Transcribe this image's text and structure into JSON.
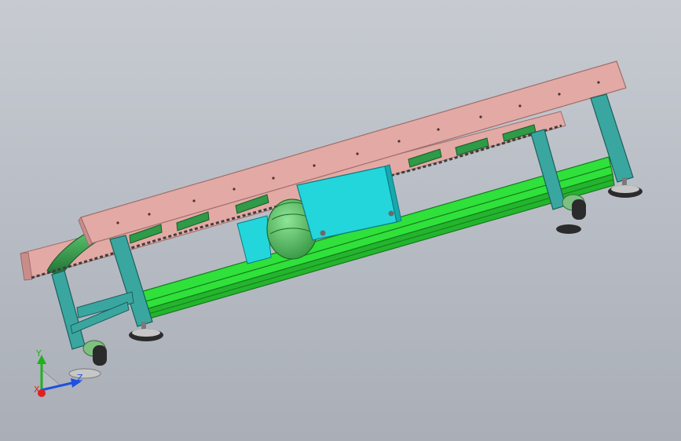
{
  "viewport": {
    "background_top": "#c7cbd1",
    "background_bottom": "#a9aeb7"
  },
  "model": {
    "colors": {
      "rail": "#e3a9a5",
      "rail_edge": "#9e6e6b",
      "leg": "#3aa6a0",
      "leg_edge": "#1c5f5b",
      "frame": "#2fe13a",
      "frame_edge": "#177a1d",
      "motor": "#5ed06a",
      "motor_cover": "#23d6dc",
      "roller": "#2f9a47",
      "chain": "#3d3d3d",
      "wheel": "#2b2b2b",
      "foot": "#c7c7c7"
    }
  },
  "triad": {
    "labels": {
      "x": "X",
      "y": "Y",
      "z": "Z"
    },
    "colors": {
      "x": "#e02020",
      "y": "#20b020",
      "z": "#2050e0"
    }
  }
}
